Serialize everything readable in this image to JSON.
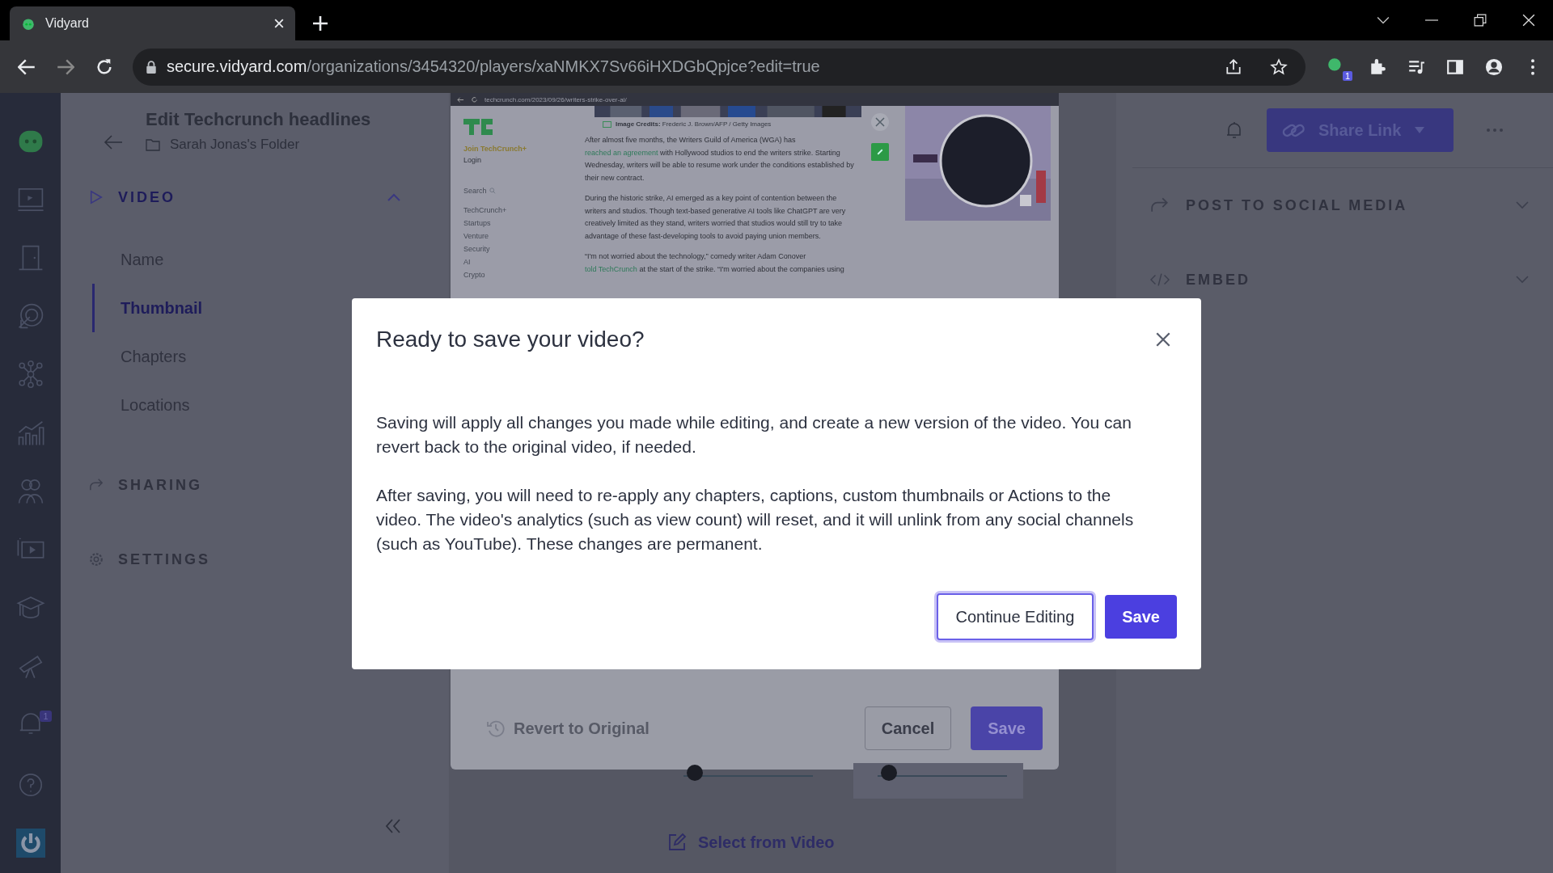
{
  "browser": {
    "tab_title": "Vidyard",
    "url_host": "secure.vidyard.com",
    "url_path": "/organizations/3454320/players/xaNMKX7Sv66iHXDGbQpjce?edit=true",
    "extension_badge": "1"
  },
  "nav_rail": {
    "notification_badge": "1"
  },
  "editor": {
    "title": "Edit Techcrunch headlines",
    "folder": "Sarah Jonas's Folder",
    "sections": [
      {
        "kind": "video",
        "label": "VIDEO",
        "expanded": true,
        "items": [
          {
            "label": "Name",
            "selected": false
          },
          {
            "label": "Thumbnail",
            "selected": true
          },
          {
            "label": "Chapters",
            "selected": false
          },
          {
            "label": "Locations",
            "selected": false
          }
        ]
      },
      {
        "kind": "sharing",
        "label": "SHARING",
        "expanded": false
      },
      {
        "kind": "settings",
        "label": "SETTINGS",
        "expanded": false
      }
    ]
  },
  "thumbnail_editor": {
    "preview": {
      "url": "techcrunch.com/2023/09/26/writers-strike-over-ai/",
      "join": "Join TechCrunch+",
      "login": "Login",
      "search": "Search",
      "nav": [
        "TechCrunch+",
        "Startups",
        "Venture",
        "Security",
        "AI",
        "Crypto"
      ],
      "caption": "**Image Credits:** Frederic J. Brown/AFP / Getty Images",
      "paragraphs": [
        {
          "segments": [
            {
              "kind": "text",
              "text": "After almost five months, the Writers Guild of America (WGA) has "
            },
            {
              "kind": "link",
              "text": "reached an agreement"
            },
            {
              "kind": "text",
              "text": " with Hollywood studios to end the writers strike. Starting Wednesday, writers will be able to resume work under the conditions established by their new contract."
            }
          ]
        },
        {
          "segments": [
            {
              "kind": "text",
              "text": "During the historic strike, AI emerged as a key point of contention between the writers and studios. Though text-based generative AI tools like ChatGPT are very creatively limited as they stand, writers worried that studios would still try to take advantage of these fast-developing tools to avoid paying union members."
            }
          ]
        },
        {
          "segments": [
            {
              "kind": "text",
              "text": "“I'm not worried about the technology,” comedy writer Adam Conover "
            },
            {
              "kind": "link",
              "text": "told TechCrunch"
            },
            {
              "kind": "text",
              "text": " at the start of the strike. “I'm worried about the companies using"
            }
          ]
        }
      ]
    },
    "revert": "Revert to Original",
    "cancel": "Cancel",
    "save": "Save",
    "select_from_video": "Select from Video"
  },
  "share": {
    "button": "Share Link",
    "sections": [
      {
        "kind": "social",
        "label": "POST TO SOCIAL MEDIA"
      },
      {
        "kind": "embed",
        "label": "EMBED"
      }
    ]
  },
  "dialog": {
    "title": "Ready to save your video?",
    "paragraphs": [
      "Saving will apply all changes you made while editing, and create a new version of the video. You can revert back to the original video, if needed.",
      "After saving, you will need to re-apply any chapters, captions, custom thumbnails or Actions to the video. The video's analytics (such as view count) will reset, and it will unlink from any social channels (such as YouTube). These changes are permanent."
    ],
    "secondary": "Continue Editing",
    "primary": "Save"
  }
}
